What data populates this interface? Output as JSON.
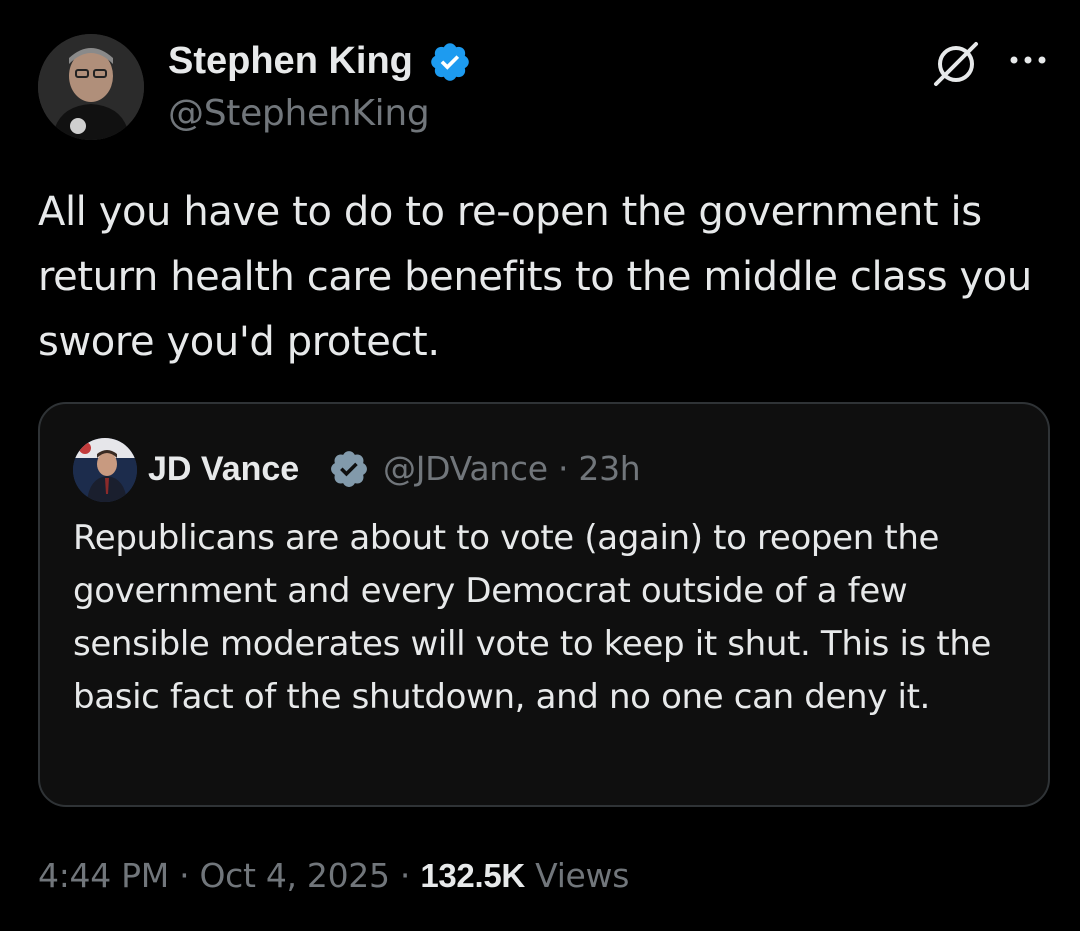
{
  "author": {
    "name": "Stephen King",
    "handle": "@StephenKing",
    "avatar_icon": "avatar-photo",
    "verified_icon": "verified-badge-icon",
    "verified_color": "#1d9bf0"
  },
  "header_actions": {
    "grok_icon": "grok-icon",
    "more_icon": "more-options-icon"
  },
  "tweet": {
    "text": "All you have to do to re-open the government is return health care benefits to the middle class you swore you'd protect."
  },
  "quoted_tweet": {
    "name": "JD Vance",
    "handle": "@JDVance",
    "separator": "·",
    "time": "23h",
    "verified_icon": "verified-badge-gray-icon",
    "verified_color": "#829aab",
    "text": "Republicans are about to vote (again) to reopen the government and every Democrat outside of a few sensible moderates will vote to keep it shut. This is the basic fact of the shutdown, and no one can deny it."
  },
  "footer": {
    "time": "4:44 PM",
    "sep1": "·",
    "date": "Oct 4, 2025",
    "sep2": "·",
    "views_count": "132.5K",
    "views_label": "Views"
  },
  "colors": {
    "background": "#000000",
    "text": "#e7e9ea",
    "secondary_text": "#71767b",
    "border": "#2f3336"
  }
}
